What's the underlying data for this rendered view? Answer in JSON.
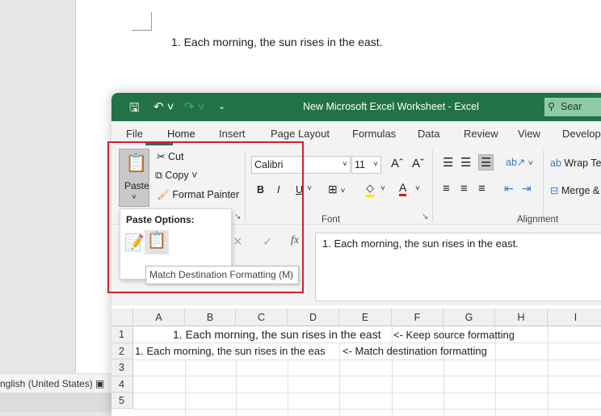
{
  "word": {
    "list_text": "1.   Each morning, the sun rises in the east.",
    "status_language": "nglish (United States)"
  },
  "excel": {
    "title": "New Microsoft Excel Worksheet  -  Excel",
    "search_label": "Sear",
    "tabs": [
      "File",
      "Home",
      "Insert",
      "Page Layout",
      "Formulas",
      "Data",
      "Review",
      "View",
      "Develop"
    ],
    "clipboard": {
      "paste": "Paste",
      "cut": "Cut",
      "copy": "Copy",
      "format_painter": "Format Painter"
    },
    "font": {
      "name": "Calibri",
      "size": "11",
      "group_label": "Font",
      "bold": "B",
      "italic": "I",
      "underline": "U"
    },
    "alignment": {
      "wrap": "Wrap Tex",
      "merge": "Merge &",
      "group_label": "Alignment"
    },
    "formula_bar": {
      "fx": "fx",
      "content": "1.   Each morning, the sun rises in the east."
    },
    "columns": [
      "A",
      "B",
      "C",
      "D",
      "E",
      "F",
      "G",
      "H",
      "I"
    ],
    "rows": [
      "1",
      "2",
      "3",
      "4",
      "5"
    ],
    "cells": {
      "r1_text": "1.  Each morning, the sun rises in the east",
      "r1_note": "<- Keep source formatting",
      "r2_text": "1.   Each morning, the sun rises in the eas",
      "r2_note": "<- Match destination formatting"
    },
    "paste_popup": {
      "title": "Paste Options:",
      "tooltip": "Match Destination Formatting (M)"
    }
  },
  "colors": {
    "excel_green": "#217346",
    "highlight_red": "#d0202a"
  }
}
